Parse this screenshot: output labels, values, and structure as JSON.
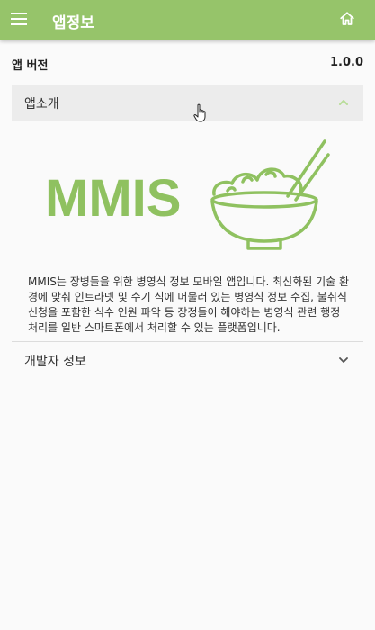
{
  "header": {
    "title": "앱정보",
    "menu_icon": "menu-icon",
    "home_icon": "home-icon",
    "color": "#96c46a"
  },
  "version": {
    "label": "앱 버전",
    "value": "1.0.0"
  },
  "about": {
    "label": "앱소개",
    "expanded": true,
    "logo_text": "MMIS",
    "logo_color": "#8fc160",
    "description": "MMIS는 장병들을 위한 병영식 정보 모바일 앱입니다. 최신화된 기술 환경에 맞춰 인트라넷 및 수기 식에 머물러 있는 병영식 정보 수집, 불취식신청을 포함한 식수 인원 파악 등 장정들이 해야하는 병영식 관련 행정 처리를 일반 스마트폰에서 처리할 수 있는 플랫폼입니다."
  },
  "developer": {
    "label": "개발자 정보",
    "expanded": false
  }
}
